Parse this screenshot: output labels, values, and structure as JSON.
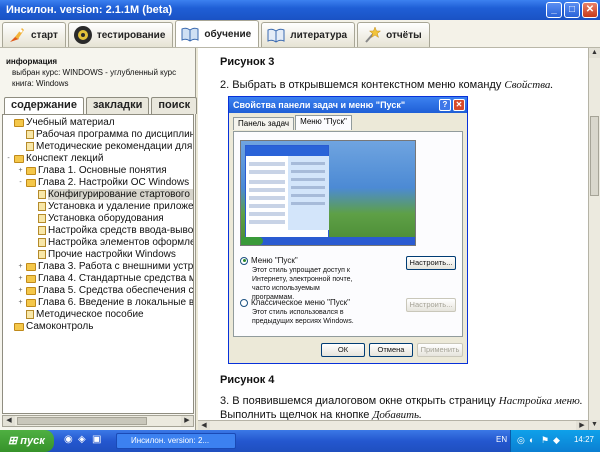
{
  "window": {
    "title": "Инсилон. version: 2.1.1M (beta)"
  },
  "top_tabs": [
    {
      "label": "старт",
      "icon": "rocket-icon"
    },
    {
      "label": "тестирование",
      "icon": "gear-icon"
    },
    {
      "label": "обучение",
      "icon": "book-icon"
    },
    {
      "label": "литература",
      "icon": "book-icon"
    },
    {
      "label": "отчёты",
      "icon": "star-icon"
    }
  ],
  "info": {
    "heading": "информация",
    "course": "выбран курс: WINDOWS - углубленный курс",
    "book": "книга: Windows"
  },
  "left_tabs": [
    "содержание",
    "закладки",
    "поиск"
  ],
  "tree": [
    {
      "label": "Учебный материал",
      "level": 0,
      "type": "folder",
      "exp": ""
    },
    {
      "label": "Рабочая программа по дисциплине",
      "level": 1,
      "type": "doc",
      "exp": ""
    },
    {
      "label": "Методические рекомендации для учащег",
      "level": 1,
      "type": "doc",
      "exp": ""
    },
    {
      "label": "Конспект лекций",
      "level": 0,
      "type": "folder",
      "exp": "-"
    },
    {
      "label": "Глава 1. Основные понятия",
      "level": 1,
      "type": "folder",
      "exp": "+"
    },
    {
      "label": "Глава 2. Настройки ОС Windows",
      "level": 1,
      "type": "folder",
      "exp": "-"
    },
    {
      "label": "Конфигурирование стартового мен",
      "level": 2,
      "type": "doc",
      "exp": "",
      "selected": true
    },
    {
      "label": "Установка и удаление приложений",
      "level": 2,
      "type": "doc",
      "exp": ""
    },
    {
      "label": "Установка оборудования",
      "level": 2,
      "type": "doc",
      "exp": ""
    },
    {
      "label": "Настройка средств ввода-вывода д",
      "level": 2,
      "type": "doc",
      "exp": ""
    },
    {
      "label": "Настройка элементов оформления",
      "level": 2,
      "type": "doc",
      "exp": ""
    },
    {
      "label": "Прочие настройки Windows",
      "level": 2,
      "type": "doc",
      "exp": ""
    },
    {
      "label": "Глава 3. Работа с внешними устройст",
      "level": 1,
      "type": "folder",
      "exp": "+"
    },
    {
      "label": "Глава 4. Стандартные средства муль",
      "level": 1,
      "type": "folder",
      "exp": "+"
    },
    {
      "label": "Глава 5. Средства обеспечения совме",
      "level": 1,
      "type": "folder",
      "exp": "+"
    },
    {
      "label": "Глава 6. Введение в локальные вычис",
      "level": 1,
      "type": "folder",
      "exp": "+"
    },
    {
      "label": "Методическое пособие",
      "level": 1,
      "type": "doc",
      "exp": ""
    },
    {
      "label": "Самоконтроль",
      "level": 0,
      "type": "folder",
      "exp": ""
    }
  ],
  "content": {
    "fig3_title": "Рисунок 3",
    "fig3_text_prefix": "2. Выбрать в открывшемся контекстном меню команду ",
    "fig3_text_italic": "Свойства.",
    "fig4_title": "Рисунок 4",
    "fig4_text_prefix": "3. В появившемся диалоговом окне открыть страницу ",
    "fig4_text_italic1": "Настройка меню.",
    "fig4_text_mid": " Выполнить щелчок на кнопке ",
    "fig4_text_italic2": "Добавить."
  },
  "dialog": {
    "title": "Свойства панели задач и меню \"Пуск\"",
    "tabs": [
      "Панель задач",
      "Меню \"Пуск\""
    ],
    "option1_label": "Меню \"Пуск\"",
    "option1_desc": "Этот стиль упрощает доступ к Интернету, электронной почте, часто используемым программам.",
    "option1_button": "Настроить...",
    "option2_label": "Классическое меню \"Пуск\"",
    "option2_desc": "Этот стиль использовался в предыдущих версиях Windows.",
    "option2_button": "Настроить...",
    "ok": "ОК",
    "cancel": "Отмена",
    "apply": "Применить"
  },
  "taskbar": {
    "start_label": "пуск",
    "task_label": "Инсилон. version: 2...",
    "lang": "EN",
    "clock": "14:27"
  }
}
